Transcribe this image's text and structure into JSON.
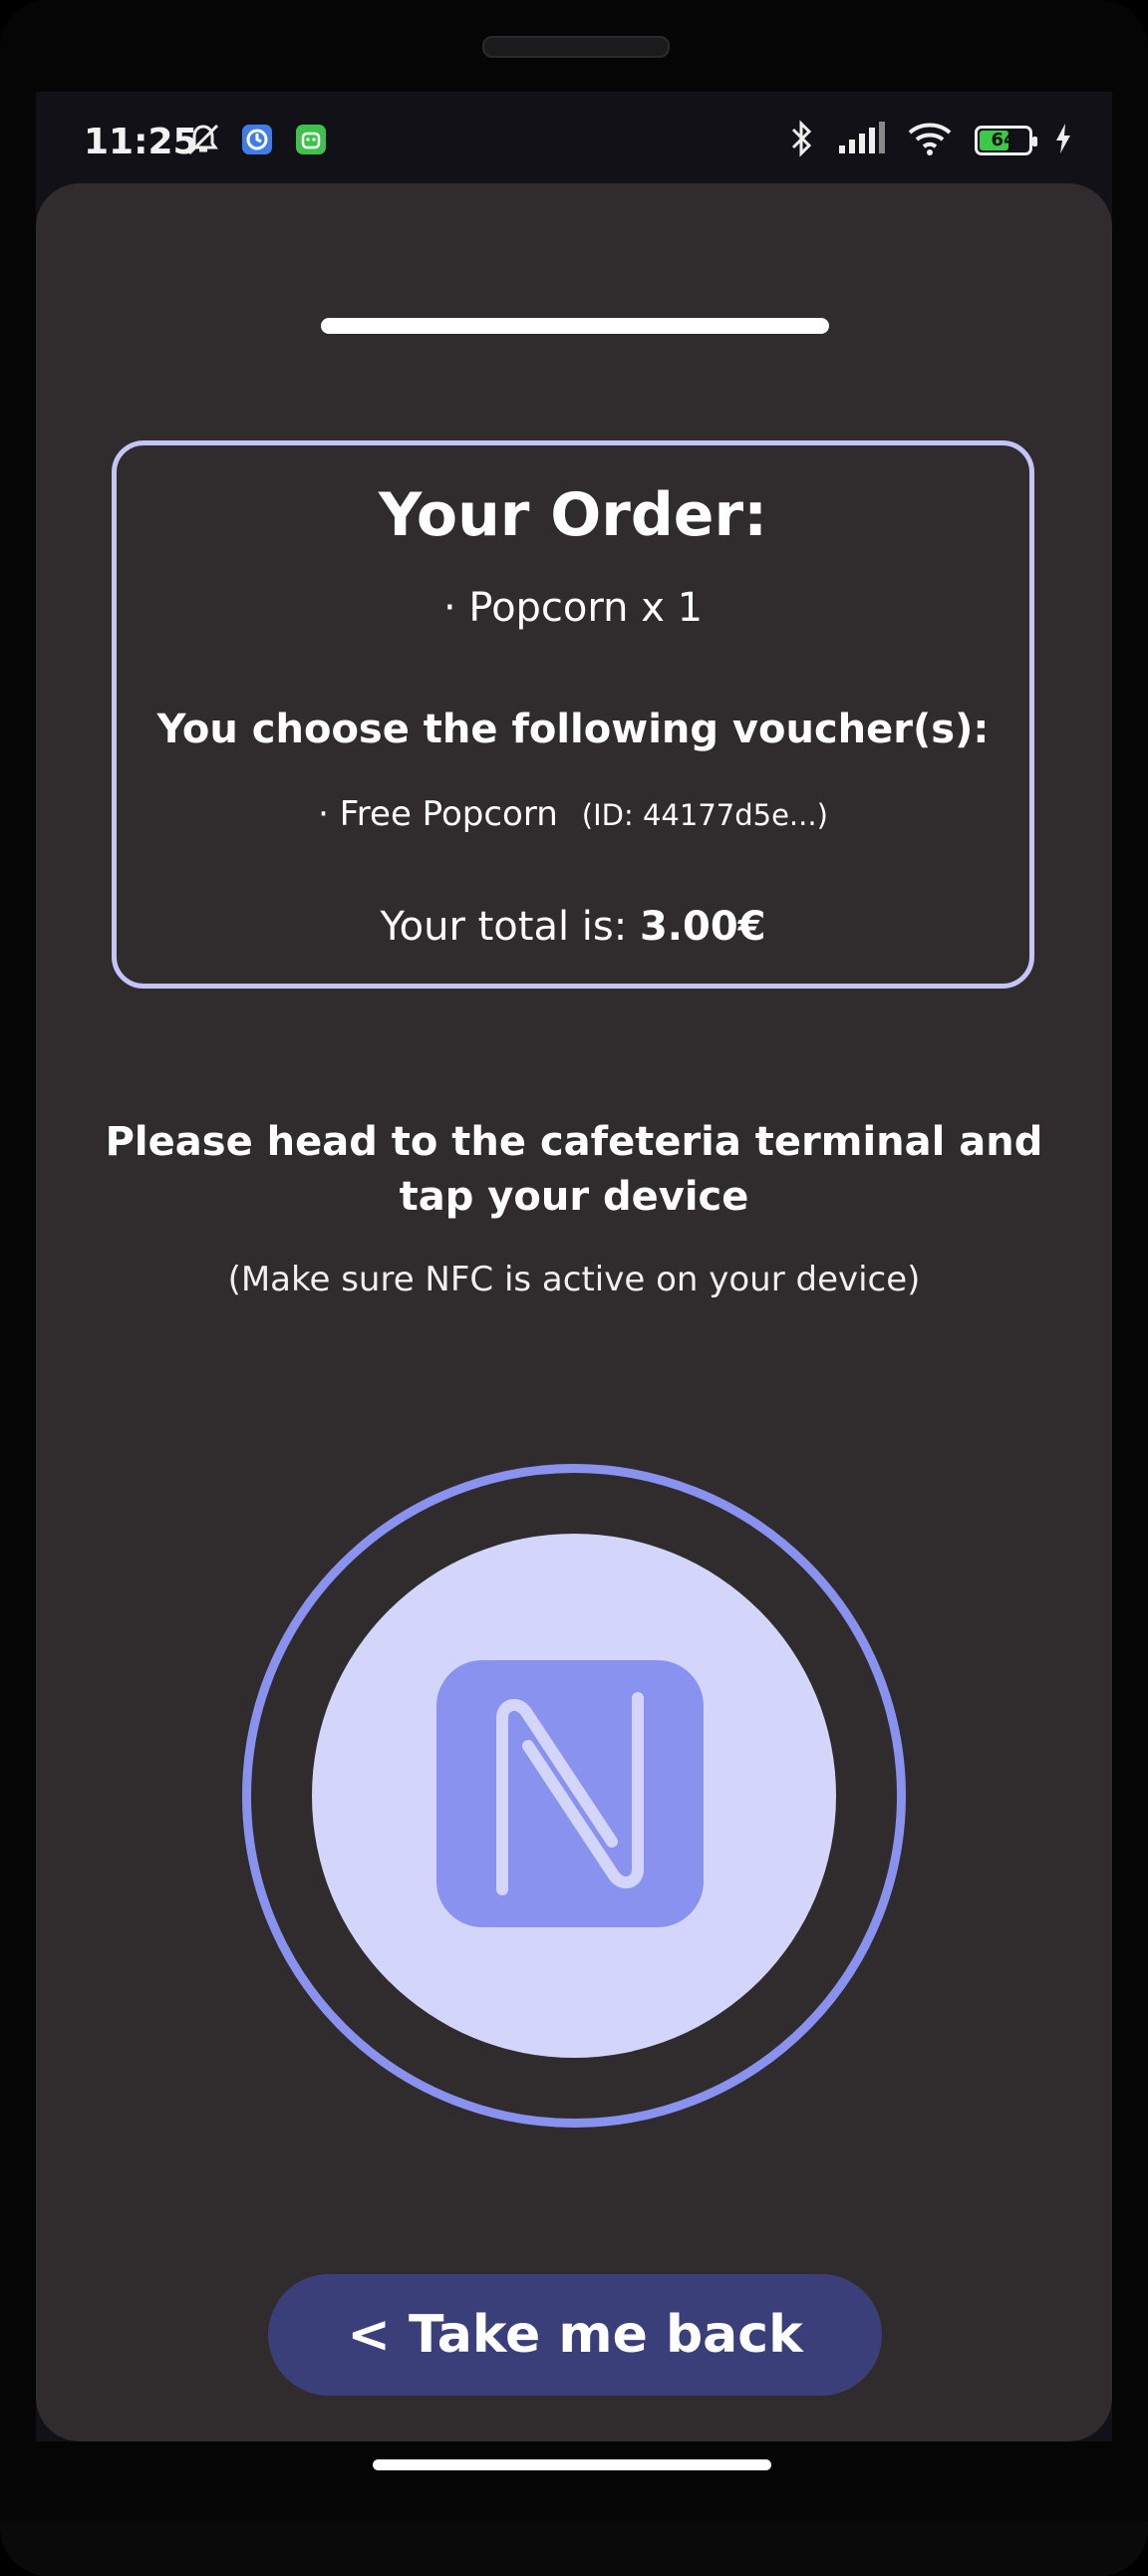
{
  "status_bar": {
    "time": "11:25",
    "left_icons": [
      "mute-notifications-icon",
      "clock-app-icon",
      "android-app-icon"
    ],
    "right_icons": [
      "bluetooth-icon",
      "signal-icon",
      "wifi-icon",
      "battery-icon",
      "charging-icon"
    ],
    "battery_level": "64",
    "colors": {
      "battery_fill": "#3cc94a",
      "clock_app": "#3f7ee8",
      "android_app": "#3ec24c"
    }
  },
  "order": {
    "title": "Your Order:",
    "items": [
      "· Popcorn x 1"
    ],
    "voucher_heading": "You choose the following voucher(s):",
    "vouchers": [
      {
        "name": "· Free Popcorn",
        "id": "(ID: 44177d5e...)"
      }
    ],
    "total_label": "Your total is: ",
    "total_value": "3.00€"
  },
  "instructions": {
    "main": "Please head to the cafeteria terminal and tap your device",
    "hint": "(Make sure NFC is active on your device)"
  },
  "nfc": {
    "icon": "nfc-icon",
    "colors": {
      "ring": "#8a92f0",
      "disc": "#d3d5fb",
      "logo": "#8a92f0"
    }
  },
  "back_button": {
    "label": "< Take me back",
    "color": "#3a3f7a"
  },
  "theme": {
    "sheet_bg": "#302c2d",
    "border_accent": "#c5c4f6"
  }
}
